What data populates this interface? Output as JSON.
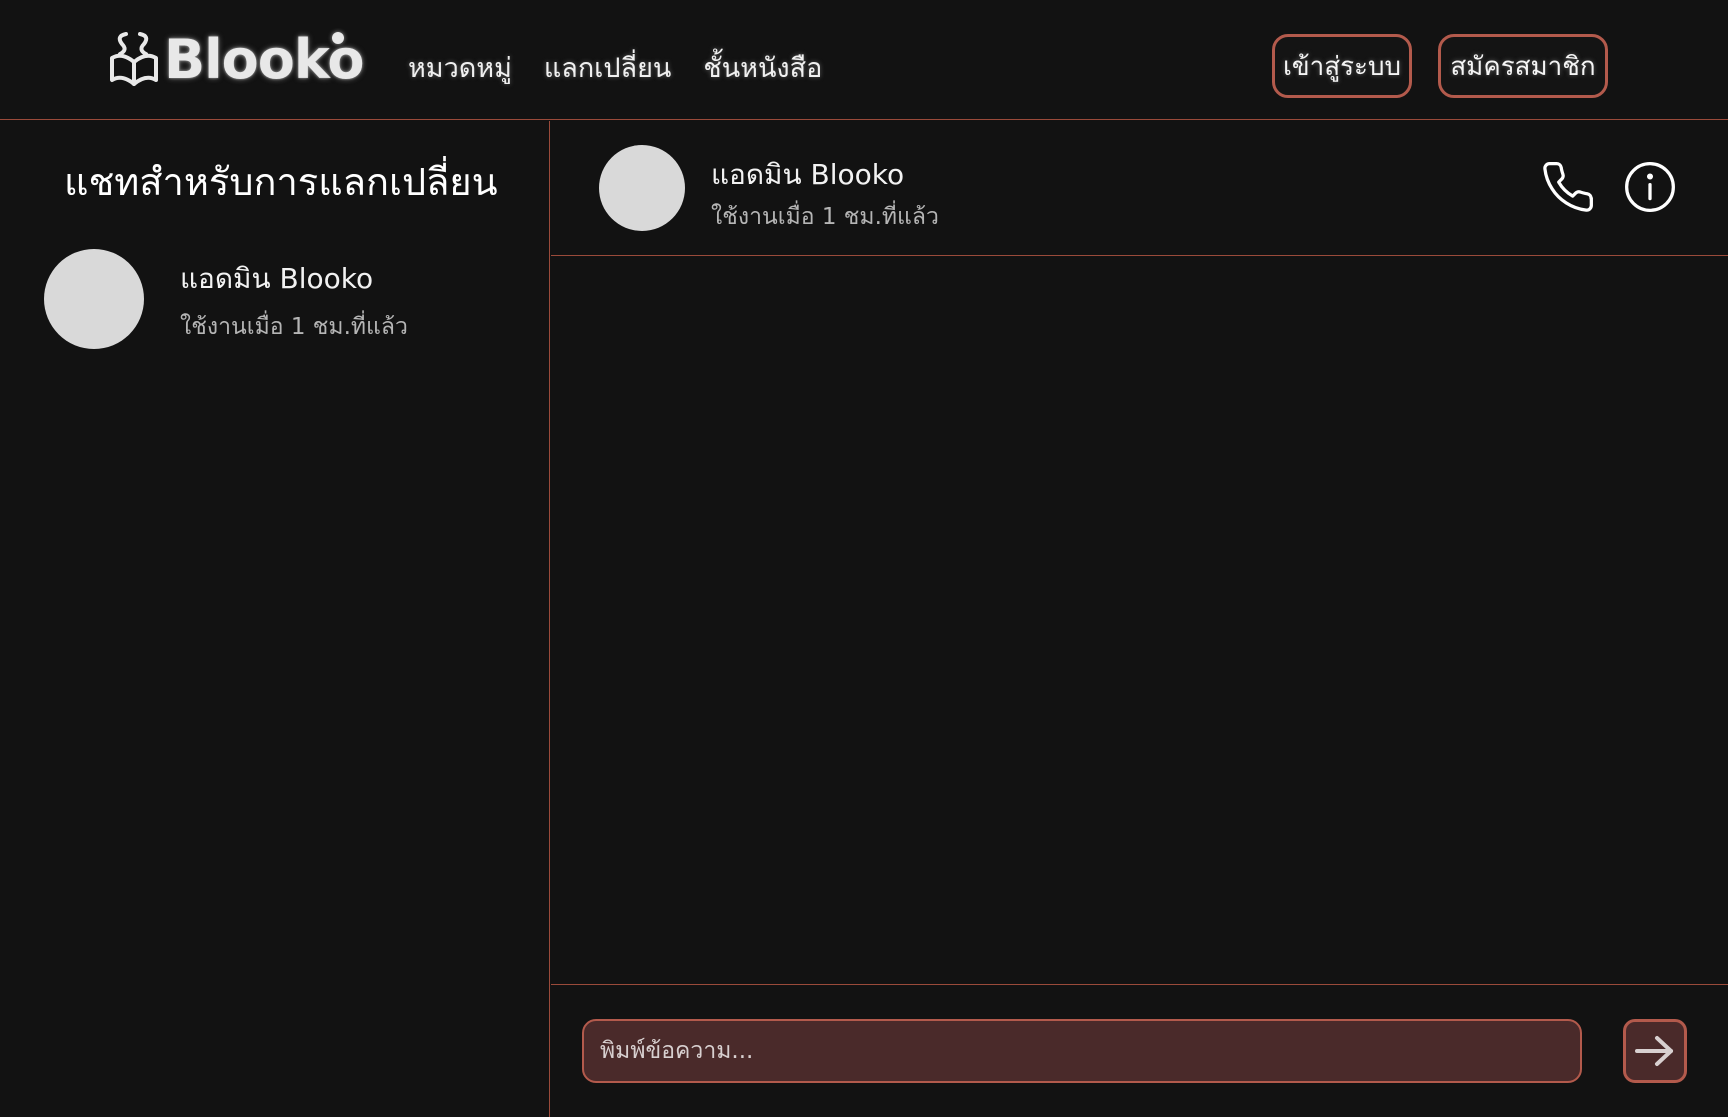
{
  "header": {
    "logo_text": "Blooko",
    "nav": [
      "หมวดหมู่",
      "แลกเปลี่ยน",
      "ชั้นหนังสือ"
    ],
    "login_label": "เข้าสู่ระบบ",
    "signup_label": "สมัครสมาชิก"
  },
  "sidebar": {
    "title": "แชทสำหรับการแลกเปลี่ยน",
    "contacts": [
      {
        "name": "แอดมิน Blooko",
        "status": "ใช้งานเมื่อ 1 ชม.ที่แล้ว"
      }
    ]
  },
  "chat": {
    "name": "แอดมิน Blooko",
    "status": "ใช้งานเมื่อ 1 ชม.ที่แล้ว",
    "call_icon": "phone-icon",
    "info_icon": "info-icon"
  },
  "composer": {
    "placeholder": "พิมพ์ข้อความ...",
    "send_icon": "arrow-right-icon"
  },
  "colors": {
    "background": "#121212",
    "accent_border": "#b35a4c",
    "divider": "#9a4a3a",
    "input_fill": "#4a2a2a",
    "avatar": "#d9d9d9"
  }
}
